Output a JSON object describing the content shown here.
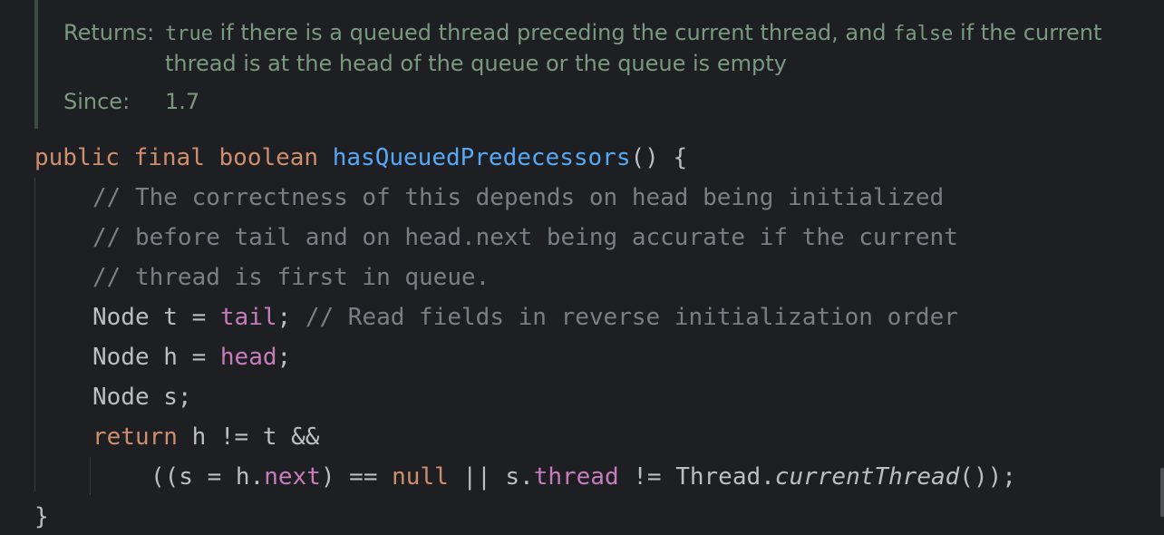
{
  "doc": {
    "returns_label": "Returns:",
    "returns_code_true": "true",
    "returns_text_1": " if there is a queued thread preceding the current thread, and ",
    "returns_code_false": "false",
    "returns_text_2": " if the current",
    "returns_line_2": "thread is at the head of the queue or the queue is empty",
    "since_label": "Since:",
    "since_value": "1.7"
  },
  "code": {
    "l1": {
      "k1": "public",
      "k2": "final",
      "k3": "boolean",
      "name": "hasQueuedPredecessors",
      "rest": "() {"
    },
    "l2": "// The correctness of this depends on head being initialized",
    "l3": "// before tail and on head.next being accurate if the current",
    "l4": "// thread is first in queue.",
    "l5": {
      "a": "Node t = ",
      "field": "tail",
      "b": "; ",
      "comment": "// Read fields in reverse initialization order"
    },
    "l6": {
      "a": "Node h = ",
      "field": "head",
      "b": ";"
    },
    "l7": "Node s;",
    "l8": {
      "kw": "return",
      "rest": " h != t &&"
    },
    "l9": {
      "a": "((s = h.",
      "f1": "next",
      "b": ") == ",
      "kw": "null",
      "c": " || s.",
      "f2": "thread",
      "d": " != Thread.",
      "call": "currentThread",
      "e": "());"
    },
    "l10": "}"
  },
  "colors": {
    "background": "#1e1f22",
    "keyword": "#cf8e6d",
    "function": "#56a8f5",
    "comment": "#7a7e85",
    "field": "#c77dbb",
    "text": "#bcbec4",
    "doc_text": "#7a9a80"
  }
}
